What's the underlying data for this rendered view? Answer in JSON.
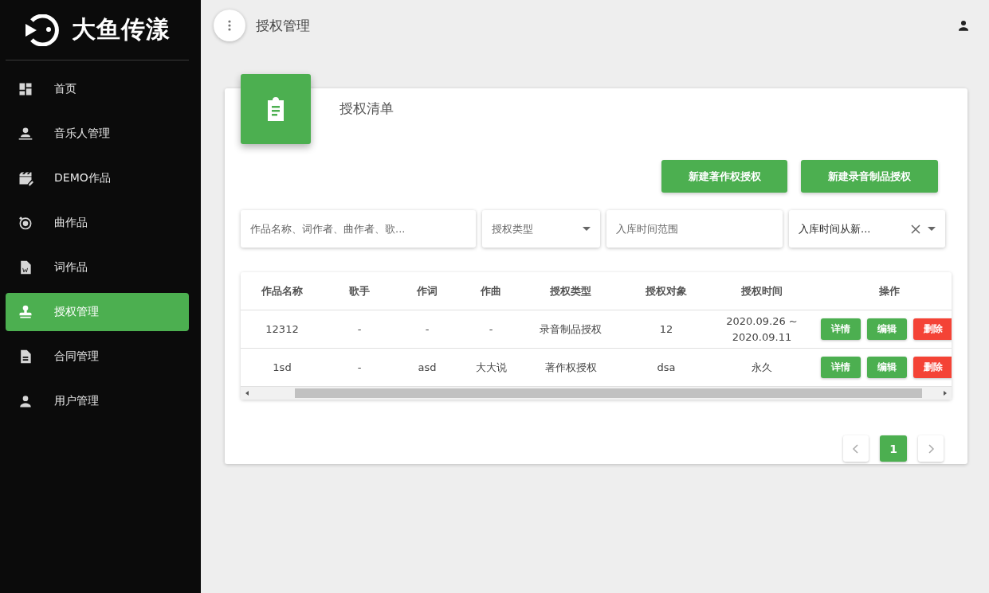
{
  "brand": {
    "name": "大鱼传漾"
  },
  "sidebar": {
    "items": [
      {
        "label": "首页",
        "selected": false
      },
      {
        "label": "音乐人管理",
        "selected": false
      },
      {
        "label": "DEMO作品",
        "selected": false
      },
      {
        "label": "曲作品",
        "selected": false
      },
      {
        "label": "词作品",
        "selected": false
      },
      {
        "label": "授权管理",
        "selected": true
      },
      {
        "label": "合同管理",
        "selected": false
      },
      {
        "label": "用户管理",
        "selected": false
      }
    ]
  },
  "topbar": {
    "title": "授权管理"
  },
  "card": {
    "title": "授权清单",
    "actions": [
      "新建著作权授权",
      "新建录音制品授权"
    ],
    "filters": [
      {
        "kind": "text",
        "placeholder": "作品名称、词作者、曲作者、歌..."
      },
      {
        "kind": "select",
        "placeholder": "授权类型"
      },
      {
        "kind": "text",
        "placeholder": "入库时间范围"
      },
      {
        "kind": "select-clear",
        "value": "入库时间从新..."
      }
    ],
    "table": {
      "columns": [
        "作品名称",
        "歌手",
        "作词",
        "作曲",
        "授权类型",
        "授权对象",
        "授权时间",
        "操作"
      ],
      "rows": [
        {
          "cells": [
            "12312",
            "-",
            "-",
            "-",
            "录音制品授权",
            "12",
            "2020.09.26 ~ 2020.09.11"
          ],
          "actions": [
            {
              "label": "详情",
              "kind": "ok"
            },
            {
              "label": "编辑",
              "kind": "ok"
            },
            {
              "label": "删除",
              "kind": "danger"
            }
          ]
        },
        {
          "cells": [
            "1sd",
            "-",
            "asd",
            "大大说",
            "著作权授权",
            "dsa",
            "永久"
          ],
          "actions": [
            {
              "label": "详情",
              "kind": "ok"
            },
            {
              "label": "编辑",
              "kind": "ok"
            },
            {
              "label": "删除",
              "kind": "danger"
            }
          ]
        }
      ]
    },
    "pagination": {
      "pages": [
        {
          "label": "1",
          "selected": true
        }
      ]
    }
  }
}
